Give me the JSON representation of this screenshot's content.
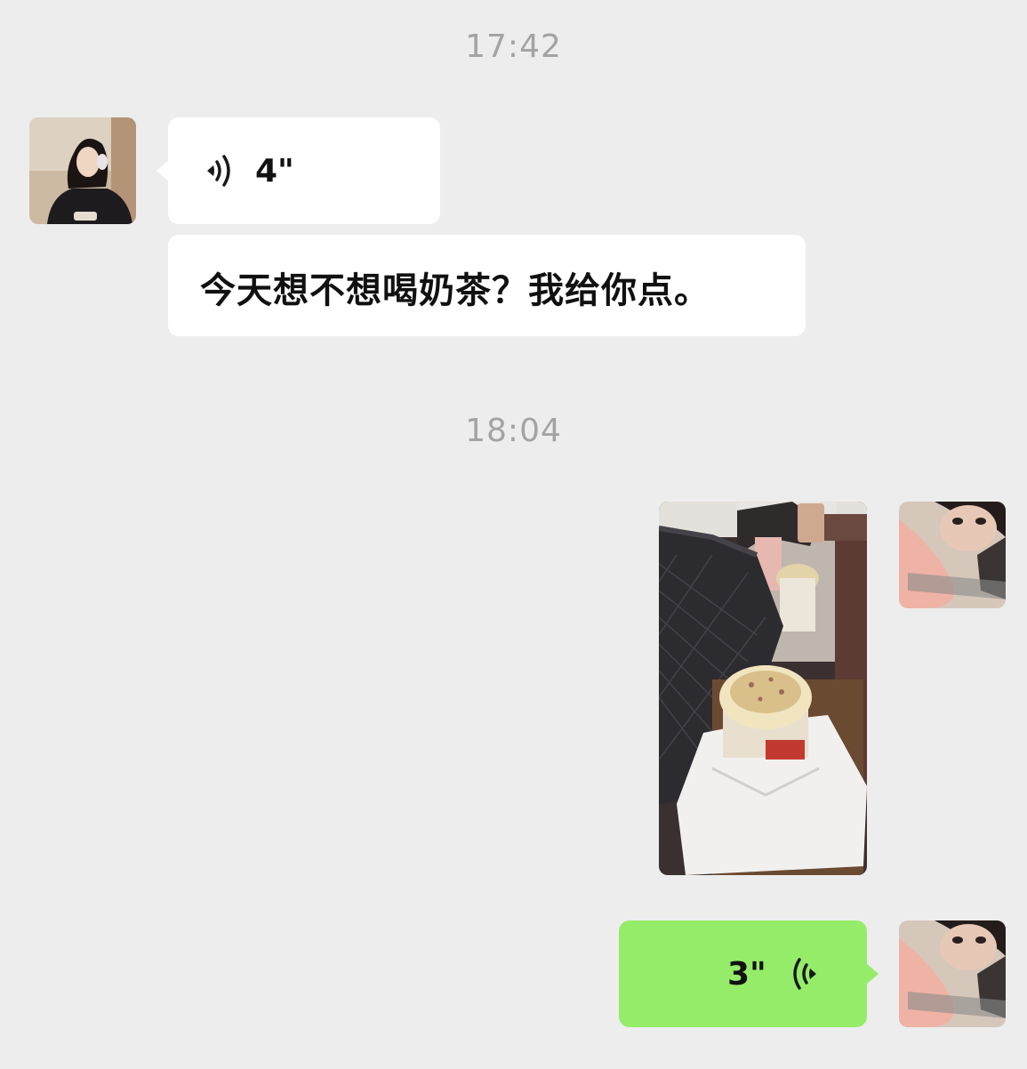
{
  "chat": {
    "messages": [
      {
        "type": "timestamp",
        "text": "17:42"
      },
      {
        "type": "voice",
        "side": "left",
        "duration": "4\"",
        "icon": "voice-wave-icon"
      },
      {
        "type": "text",
        "side": "left",
        "text": "今天想不想喝奶茶？我给你点。"
      },
      {
        "type": "timestamp",
        "text": "18:04"
      },
      {
        "type": "image",
        "side": "right"
      },
      {
        "type": "voice",
        "side": "right",
        "duration": "3\"",
        "icon": "voice-wave-icon"
      }
    ]
  },
  "colors": {
    "background": "#ededed",
    "bubble_left": "#ffffff",
    "bubble_right": "#95ec69",
    "timestamp": "#a3a3a3"
  }
}
